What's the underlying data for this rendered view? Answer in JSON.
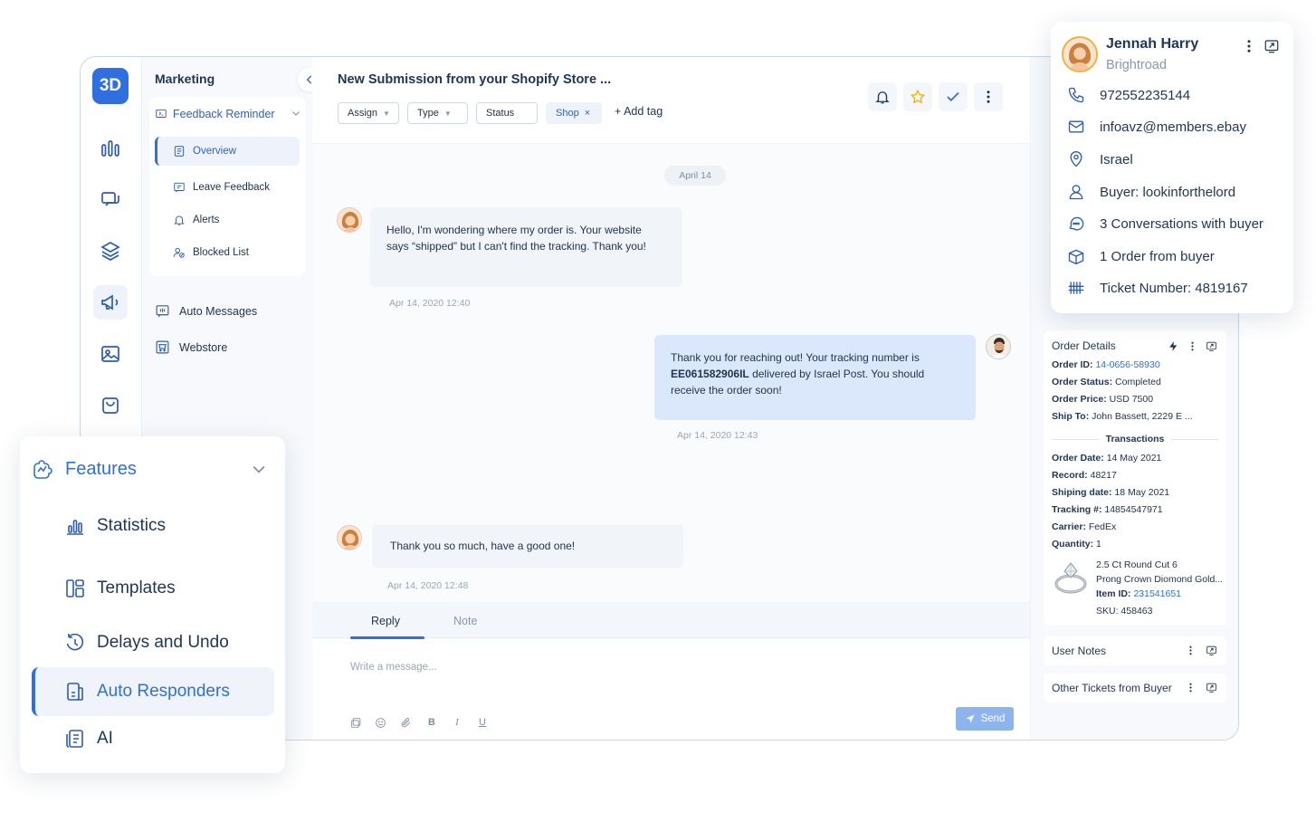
{
  "sidebar": {
    "logo": "3D",
    "section_title": "Marketing",
    "group": {
      "label": "Feedback Reminder",
      "items": [
        {
          "label": "Overview",
          "icon": "overview-icon"
        },
        {
          "label": "Leave Feedback",
          "icon": "feedback-icon"
        },
        {
          "label": "Alerts",
          "icon": "bell-icon"
        },
        {
          "label": "Blocked List",
          "icon": "blocked-icon"
        }
      ]
    },
    "links": [
      {
        "label": "Auto Messages",
        "icon": "auto-messages-icon"
      },
      {
        "label": "Webstore",
        "icon": "webstore-icon"
      }
    ]
  },
  "header": {
    "title": "New Submission from your Shopify Store ...",
    "filters": [
      {
        "label": "Assign"
      },
      {
        "label": "Type"
      },
      {
        "label": "Status"
      }
    ],
    "tag": {
      "label": "Shop",
      "remove": "×"
    },
    "add_tag": "+ Add tag"
  },
  "thread": {
    "date": "April 14",
    "messages": [
      {
        "text": "Hello, I'm wondering where my order is. Your website says “shipped” but I can't find the tracking. Thank you!",
        "time": "Apr 14, 2020 12:40"
      },
      {
        "text_before": "Thank you for reaching out! Your tracking number is ",
        "tracking": "EE061582906IL",
        "text_after": " delivered by Israel Post. You should receive the order soon!",
        "time": "Apr 14, 2020 12:43"
      },
      {
        "text": "Thank you so much, have a good one!",
        "time": "Apr 14, 2020 12:48"
      }
    ]
  },
  "composer": {
    "tabs": [
      "Reply",
      "Note"
    ],
    "placeholder": "Write a message...",
    "send": "Send"
  },
  "contact": {
    "name": "Jennah Harry",
    "company": "Brightroad",
    "phone": "972552235144",
    "email": "infoavz@members.ebay",
    "location": "Israel",
    "buyer": "Buyer: lookinforthelord",
    "conversations": "3 Conversations with buyer",
    "orders": "1 Order from buyer",
    "ticket": "Ticket Number: 4819167"
  },
  "order": {
    "title": "Order Details",
    "order_id_label": "Order ID:",
    "order_id": "14-0656-58930",
    "status_label": "Order Status:",
    "status": "Completed",
    "price_label": "Order Price:",
    "price": "USD 7500",
    "ship_label": "Ship To:",
    "ship": "John Bassett, 2229 E ...",
    "transactions": "Transactions",
    "order_date_label": "Order Date:",
    "order_date": "14 May 2021",
    "record_label": "Record:",
    "record": "48217",
    "ship_date_label": "Shiping date:",
    "ship_date": "18 May 2021",
    "tracking_label": "Tracking #:",
    "tracking": "14854547971",
    "carrier_label": "Carrier:",
    "carrier": "FedEx",
    "quantity_label": "Quantity:",
    "quantity": "1",
    "product_line1": "2.5 Ct Round Cut 6",
    "product_line2": "Prong Crown Diomond Gold...",
    "item_id_label": "Item ID:",
    "item_id": "231541651",
    "sku": "SKU: 458463"
  },
  "panels": {
    "user_notes": "User Notes",
    "other_tickets": "Other Tickets from Buyer"
  },
  "features": {
    "title": "Features",
    "items": [
      {
        "label": "Statistics",
        "icon": "bar-chart-icon"
      },
      {
        "label": "Templates",
        "icon": "templates-icon"
      },
      {
        "label": "Delays and Undo",
        "icon": "undo-icon"
      },
      {
        "label": "Auto Responders",
        "icon": "auto-responder-icon"
      },
      {
        "label": "AI",
        "icon": "ai-icon"
      }
    ]
  },
  "colors": {
    "accent": "#2f6fe0",
    "outgoing_bubble": "#dbe8fb",
    "incoming_bubble": "#f1f4f8",
    "send_button": "#8eb4ee",
    "star": "#f5b400"
  }
}
